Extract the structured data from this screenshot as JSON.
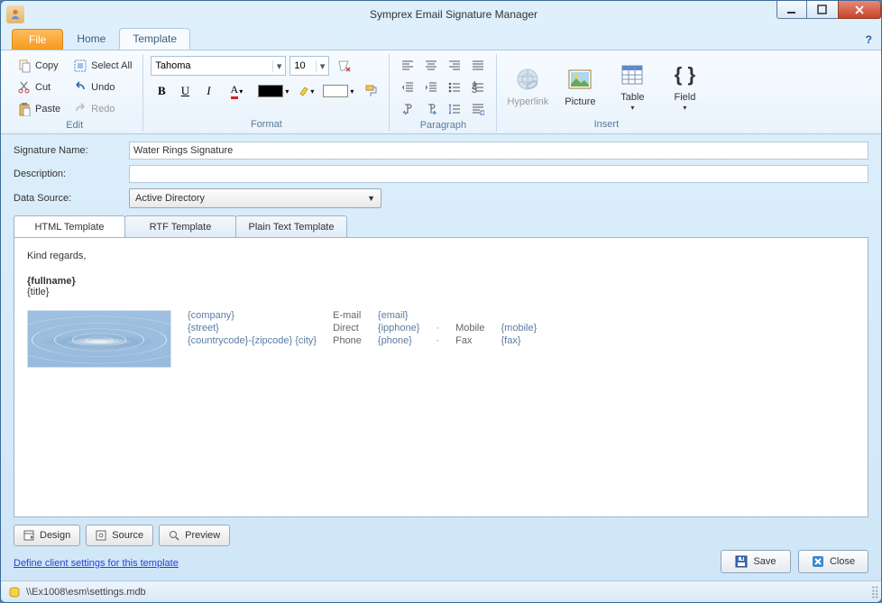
{
  "window": {
    "title": "Symprex Email Signature Manager"
  },
  "tabs": {
    "file": "File",
    "home": "Home",
    "template": "Template"
  },
  "ribbon": {
    "edit": {
      "label": "Edit",
      "copy": "Copy",
      "cut": "Cut",
      "paste": "Paste",
      "selectall": "Select All",
      "undo": "Undo",
      "redo": "Redo"
    },
    "format": {
      "label": "Format",
      "font": "Tahoma",
      "size": "10"
    },
    "paragraph": {
      "label": "Paragraph"
    },
    "insert": {
      "label": "Insert",
      "hyperlink": "Hyperlink",
      "picture": "Picture",
      "table": "Table",
      "field": "Field"
    }
  },
  "fields": {
    "signame_label": "Signature Name:",
    "signame_value": "Water Rings Signature",
    "desc_label": "Description:",
    "desc_value": "",
    "datasource_label": "Data Source:",
    "datasource_value": "Active Directory"
  },
  "doctabs": {
    "html": "HTML Template",
    "rtf": "RTF Template",
    "plain": "Plain Text Template"
  },
  "content": {
    "regards": "Kind regards,",
    "fullname": "{fullname}",
    "title": "{title}",
    "company": "{company}",
    "street": "{street}",
    "cityline": "{countrycode}-{zipcode} {city}",
    "email_l": "E-mail",
    "email_v": "{email}",
    "direct_l": "Direct",
    "direct_v": "{ipphone}",
    "phone_l": "Phone",
    "phone_v": "{phone}",
    "mobile_l": "Mobile",
    "mobile_v": "{mobile}",
    "fax_l": "Fax",
    "fax_v": "{fax}"
  },
  "design": {
    "design": "Design",
    "source": "Source",
    "preview": "Preview"
  },
  "link": "Define client settings for this template",
  "buttons": {
    "save": "Save",
    "close": "Close"
  },
  "status": "\\\\Ex1008\\esm\\settings.mdb"
}
